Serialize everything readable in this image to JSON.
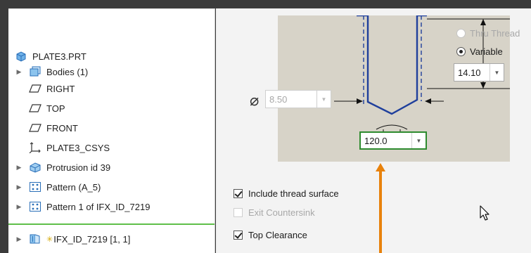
{
  "model_tree": {
    "items": [
      {
        "label": "PLATE3.PRT",
        "icon": "part-icon",
        "expandable": false
      },
      {
        "label": "Bodies (1)",
        "icon": "bodies-icon",
        "expandable": true
      },
      {
        "label": "RIGHT",
        "icon": "datum-plane-icon",
        "expandable": false
      },
      {
        "label": "TOP",
        "icon": "datum-plane-icon",
        "expandable": false
      },
      {
        "label": "FRONT",
        "icon": "datum-plane-icon",
        "expandable": false
      },
      {
        "label": "PLATE3_CSYS",
        "icon": "csys-icon",
        "expandable": false
      },
      {
        "label": "Protrusion id 39",
        "icon": "protrusion-icon",
        "expandable": true
      },
      {
        "label": "Pattern (A_5)",
        "icon": "pattern-icon",
        "expandable": true
      },
      {
        "label": "Pattern 1 of IFX_ID_7219",
        "icon": "pattern-icon",
        "expandable": true
      },
      {
        "label": "IFX_ID_7219 [1, 1]",
        "icon": "feature-icon",
        "expandable": true,
        "star": "✳"
      }
    ]
  },
  "depth_options": {
    "thru_thread": "Thru Thread",
    "variable": "Variable",
    "selected": "Variable"
  },
  "depth_value": "14.10",
  "diameter_value": "8.50",
  "angle_value": "120.0",
  "options": {
    "include_thread_surface": {
      "label": "Include thread surface",
      "checked": true,
      "enabled": true
    },
    "exit_countersink": {
      "label": "Exit Countersink",
      "checked": false,
      "enabled": false
    },
    "top_clearance": {
      "label": "Top Clearance",
      "checked": true,
      "enabled": true
    }
  },
  "colors": {
    "profile": "#1f3f9c",
    "highlight": "#2e8b2e",
    "arrow": "#e8820c",
    "divider": "#5fbf4a"
  }
}
